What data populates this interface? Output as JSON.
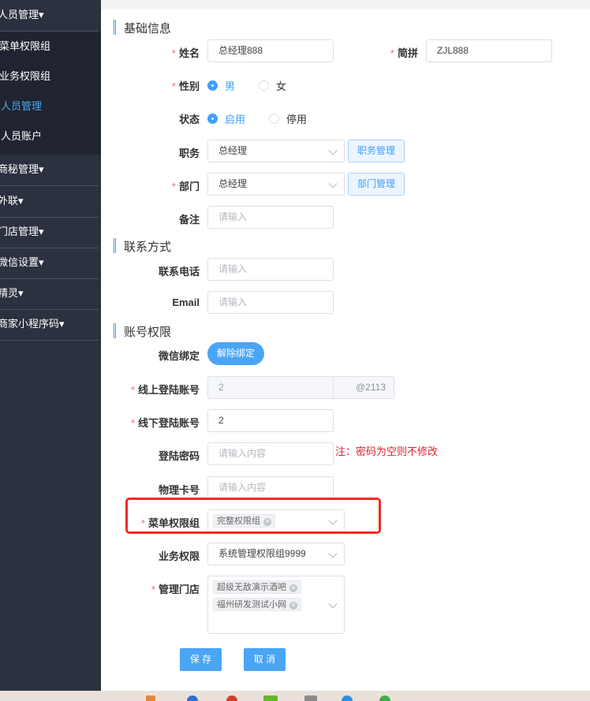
{
  "sidebar": {
    "groups": [
      {
        "label": "人员管理▾"
      },
      {
        "label": "商秘管理▾"
      },
      {
        "label": "外联▾"
      },
      {
        "label": "门店管理▾"
      },
      {
        "label": "微信设置▾"
      },
      {
        "label": "精灵▾"
      },
      {
        "label": "商家小程序码▾"
      }
    ],
    "subitems": [
      {
        "label": "菜单权限组"
      },
      {
        "label": "业务权限组"
      },
      {
        "label": "人员管理"
      },
      {
        "label": "人员账户"
      }
    ]
  },
  "sections": {
    "basic": "基础信息",
    "contact": "联系方式",
    "account": "账号权限"
  },
  "form": {
    "name_label": "姓名",
    "name_value": "总经理888",
    "pinyin_label": "简拼",
    "pinyin_value": "ZJL888",
    "gender_label": "性别",
    "gender_male": "男",
    "gender_female": "女",
    "status_label": "状态",
    "status_on": "启用",
    "status_off": "停用",
    "position_label": "职务",
    "position_value": "总经理",
    "position_btn": "职务管理",
    "dept_label": "部门",
    "dept_value": "总经理",
    "dept_btn": "部门管理",
    "remark_label": "备注",
    "remark_placeholder": "请输入",
    "phone_label": "联系电话",
    "phone_placeholder": "请输入",
    "email_label": "Email",
    "email_placeholder": "请输入",
    "wechat_label": "微信绑定",
    "wechat_btn": "解除绑定",
    "online_label": "线上登陆账号",
    "online_value": "2",
    "online_suffix": "@2113",
    "offline_label": "线下登陆账号",
    "offline_value": "2",
    "password_label": "登陆密码",
    "password_placeholder": "请输入内容",
    "password_hint": "注：密码为空则不修改",
    "card_label": "物理卡号",
    "card_placeholder": "请输入内容",
    "menu_perm_label": "菜单权限组",
    "menu_perm_tag": "完整权限组",
    "biz_perm_label": "业务权限",
    "biz_perm_value": "系统管理权限组9999",
    "stores_label": "管理门店",
    "stores": [
      "超级无敌演示酒吧",
      "福州研发测试小网"
    ],
    "save_btn": "保 存",
    "cancel_btn": "取 消"
  },
  "colors": {
    "accent": "#409eff",
    "required": "#f56c6c",
    "hint": "#e0212e",
    "highlight": "#ef2b22",
    "sidebar_bg": "#2b313f"
  }
}
